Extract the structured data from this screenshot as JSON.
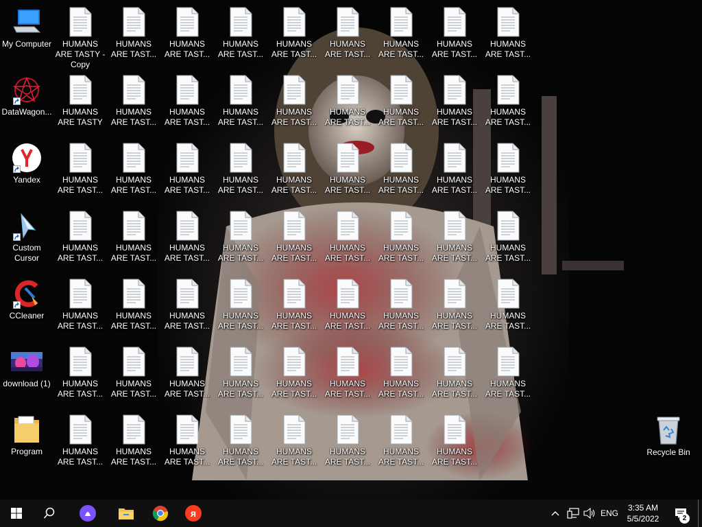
{
  "desktop": {
    "system_icons": [
      {
        "label": "My Computer",
        "icon": "computer-icon"
      },
      {
        "label": "DataWagon...",
        "icon": "datawagon-icon",
        "shortcut": true
      },
      {
        "label": "Yandex",
        "icon": "yandex-icon",
        "shortcut": true
      },
      {
        "label": "Custom Cursor",
        "icon": "custom-cursor-icon",
        "shortcut": true
      },
      {
        "label": "CCleaner",
        "icon": "ccleaner-icon",
        "shortcut": true
      },
      {
        "label": "download (1)",
        "icon": "image-file-icon"
      },
      {
        "label": "Program",
        "icon": "folder-icon"
      }
    ],
    "first_file_label": "HUMANS ARE TASTY - Copy",
    "second_file_label": "HUMANS ARE TASTY",
    "file_label": "HUMANS ARE TAST...",
    "file_icon": "text-file-icon",
    "file_grid": {
      "rows": 7,
      "columns": 9,
      "last_row_columns": 8
    },
    "recycle_bin": {
      "label": "Recycle Bin",
      "icon": "recycle-bin-icon"
    }
  },
  "taskbar": {
    "start": "windows-start-icon",
    "search": "search-icon",
    "pinned": [
      {
        "name": "alice-assistant-icon",
        "color": "#6a4cff"
      },
      {
        "name": "file-explorer-icon",
        "color": "#f2c14e"
      },
      {
        "name": "chrome-icon",
        "color": "#e33b2e"
      },
      {
        "name": "yandex-browser-icon",
        "color": "#ff3b1f"
      }
    ],
    "tray": {
      "chevron": "chevron-up-icon",
      "network": "network-icon",
      "volume": "volume-icon",
      "language": "ENG",
      "time": "3:35 AM",
      "date": "5/5/2022",
      "notifications": "notification-icon",
      "notification_count": "2"
    }
  },
  "colors": {
    "taskbar": "#101010",
    "wallpaper_accent": "#8a1c22"
  }
}
